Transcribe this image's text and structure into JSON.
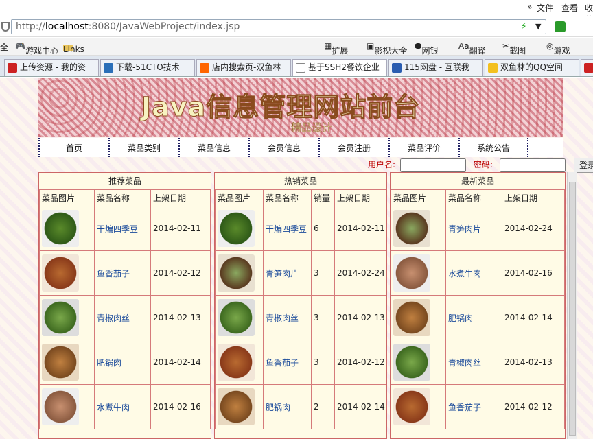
{
  "browser": {
    "menu": [
      "»",
      "文件",
      "查看",
      "收藏"
    ],
    "address_prefix": "http://",
    "address_host": "localhost",
    "address_rest": ":8080/JavaWebProject/index.jsp",
    "favorites": [
      "全",
      "游戏中心",
      "Links"
    ],
    "toolbar_right": [
      "扩展",
      "影视大全",
      "网银",
      "翻译",
      "截图",
      "游戏"
    ],
    "tabs": [
      "上传资源 - 我的资",
      "下载-51CTO技术",
      "店内搜索页-双鱼林",
      "基于SSH2餐饮企业",
      "115网盘 - 互联我",
      "双鱼林的QQ空间"
    ]
  },
  "site": {
    "title": "Java信息管理网站前台",
    "subtitle": "精品设计"
  },
  "nav": [
    "首页",
    "菜品类别",
    "菜品信息",
    "会员信息",
    "会员注册",
    "菜品评价",
    "系统公告"
  ],
  "login": {
    "user_label": "用户名:",
    "pass_label": "密码:",
    "button": "登录"
  },
  "recommend": {
    "title": "推荐菜品",
    "headers": [
      "菜品图片",
      "菜品名称",
      "上架日期"
    ],
    "rows": [
      {
        "name": "干煸四季豆",
        "date": "2014-02-11"
      },
      {
        "name": "鱼香茄子",
        "date": "2014-02-12"
      },
      {
        "name": "青椒肉丝",
        "date": "2014-02-13"
      },
      {
        "name": "肥锅肉",
        "date": "2014-02-14"
      },
      {
        "name": "水煮牛肉",
        "date": "2014-02-16"
      }
    ]
  },
  "hot": {
    "title": "热销菜品",
    "headers": [
      "菜品图片",
      "菜品名称",
      "销量",
      "上架日期"
    ],
    "rows": [
      {
        "name": "干煸四季豆",
        "sales": "6",
        "date": "2014-02-11"
      },
      {
        "name": "青笋肉片",
        "sales": "3",
        "date": "2014-02-24"
      },
      {
        "name": "青椒肉丝",
        "sales": "3",
        "date": "2014-02-13"
      },
      {
        "name": "鱼香茄子",
        "sales": "3",
        "date": "2014-02-12"
      },
      {
        "name": "肥锅肉",
        "sales": "2",
        "date": "2014-02-14"
      }
    ]
  },
  "newest": {
    "title": "最新菜品",
    "headers": [
      "菜品图片",
      "菜品名称",
      "上架日期"
    ],
    "rows": [
      {
        "name": "青笋肉片",
        "date": "2014-02-24"
      },
      {
        "name": "水煮牛肉",
        "date": "2014-02-16"
      },
      {
        "name": "肥锅肉",
        "date": "2014-02-14"
      },
      {
        "name": "青椒肉丝",
        "date": "2014-02-13"
      },
      {
        "name": "鱼香茄子",
        "date": "2014-02-12"
      }
    ]
  }
}
